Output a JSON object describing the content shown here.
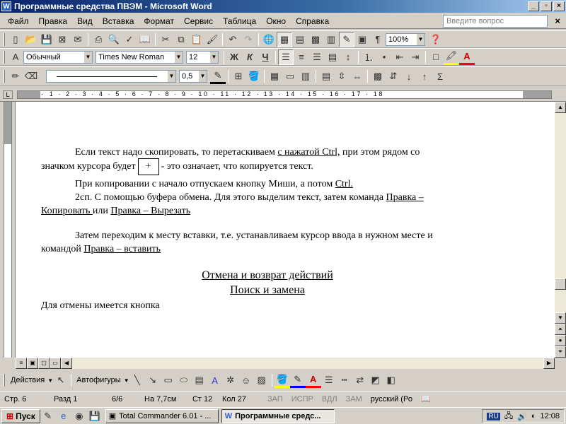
{
  "window": {
    "title": "Программные средства ПВЭМ - Microsoft Word",
    "icon": "W"
  },
  "menu": {
    "items": [
      "Файл",
      "Правка",
      "Вид",
      "Вставка",
      "Формат",
      "Сервис",
      "Таблица",
      "Окно",
      "Справка"
    ],
    "ask_placeholder": "Введите вопрос"
  },
  "toolbar_std": {
    "zoom": "100%"
  },
  "toolbar_fmt": {
    "style": "Обычный",
    "font": "Times New Roman",
    "size": "12",
    "bold": "Ж",
    "italic": "К",
    "underline": "Ч"
  },
  "toolbar_draw2": {
    "line_weight": "0,5"
  },
  "ruler": {
    "marks": "· 1 · 2 · 3 · 4 · 5 · 6 · 7 · 8 · 9 · 10 · 11 · 12 · 13 · 14 · 15 · 16 · 17 · 18"
  },
  "document": {
    "p1_a": "Если текст надо скопировать, то перетаскиваем ",
    "p1_link": "с нажатой Ctrl,",
    "p1_b": " при этом рядом со",
    "p1_c": "значком курсора будет",
    "p1_plus": "+",
    "p1_d": "- это означает, что копируется текст.",
    "p2_a": "При копировании с начало отпускаем кнопку Миши, а потом ",
    "p2_ctrl": "Ctrl.",
    "p3_a": "2сп. С помощью буфера обмена. Для этого выделим текст, затем команда ",
    "p3_link1": "Правка –",
    "p3_link1b": "Копировать ",
    "p3_or": " или ",
    "p3_link2": "Правка – Вырезать",
    "p4_a": "Затем переходим к месту вставки, т.е. устанавливаем курсор ввода в нужном месте и",
    "p4_b": "командой ",
    "p4_link": " Правка – вставить",
    "heading1": "Отмена и возврат действий",
    "heading2": "Поиск и замена",
    "p5": "Для отмены имеется кнопка"
  },
  "drawbar": {
    "actions": "Действия",
    "autoshapes": "Автофигуры"
  },
  "status": {
    "page": "Стр. 6",
    "section": "Разд 1",
    "pages": "6/6",
    "pos": "На 7,7см",
    "line": "Ст 12",
    "col": "Кол 27",
    "rec": "ЗАП",
    "trk": "ИСПР",
    "ext": "ВДЛ",
    "ovr": "ЗАМ",
    "lang": "русский (Ро"
  },
  "taskbar": {
    "start": "Пуск",
    "task1": "Total Commander 6.01 - ...",
    "task2": "Программные средс...",
    "lang": "RU",
    "clock": "12:08"
  }
}
